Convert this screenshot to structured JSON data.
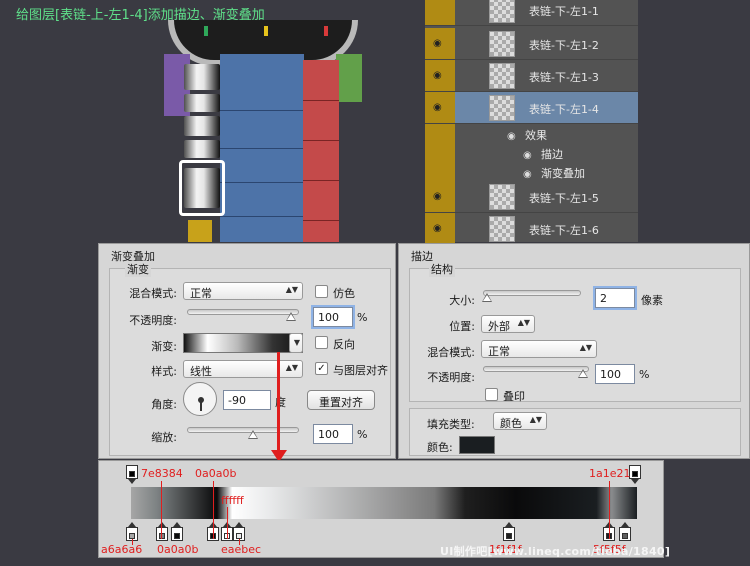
{
  "title": "给图层[表链-上-左1-4]添加描边、渐变叠加",
  "layers": {
    "items": [
      {
        "name": "表链-下-左1-1"
      },
      {
        "name": "表链-下-左1-2"
      },
      {
        "name": "表链-下-左1-3"
      },
      {
        "name": "表链-下-左1-4",
        "selected": true
      },
      {
        "name": "表链-下-左1-5"
      },
      {
        "name": "表链-下-左1-6"
      }
    ],
    "effects_label": "效果",
    "effect_items": [
      "描边",
      "渐变叠加"
    ]
  },
  "gradient_overlay": {
    "title": "渐变叠加",
    "group_label": "渐变",
    "blend_mode_label": "混合模式:",
    "blend_mode_value": "正常",
    "dither_label": "仿色",
    "opacity_label": "不透明度:",
    "opacity_value": "100",
    "opacity_unit": "%",
    "gradient_label": "渐变:",
    "reverse_label": "反向",
    "style_label": "样式:",
    "style_value": "线性",
    "align_label": "与图层对齐",
    "angle_label": "角度:",
    "angle_value": "-90",
    "angle_unit": "度",
    "reset_button": "重置对齐",
    "scale_label": "缩放:",
    "scale_value": "100",
    "scale_unit": "%"
  },
  "stroke": {
    "title": "描边",
    "group_label": "结构",
    "size_label": "大小:",
    "size_value": "2",
    "size_unit": "像素",
    "position_label": "位置:",
    "position_value": "外部",
    "blend_mode_label": "混合模式:",
    "blend_mode_value": "正常",
    "opacity_label": "不透明度:",
    "opacity_value": "100",
    "opacity_unit": "%",
    "overprint_label": "叠印",
    "fill_type_label": "填充类型:",
    "fill_type_value": "颜色",
    "color_label": "颜色:",
    "color_value": "#1a1e21"
  },
  "gradient_editor": {
    "labels": {
      "c1": "7e8384",
      "c2": "0a0a0b",
      "c3": "ffffff",
      "c4": "1a1e21",
      "b1": "a6a6a6",
      "b2": "0a0a0b",
      "b3": "eaebec",
      "b4": "1f1f1f",
      "b5": "5f5f5f"
    }
  },
  "watermark": "UI制作吧[www.lineq.com/tieba/1840]",
  "colors": {
    "accent_green": "#5fe08a",
    "annotation_red": "#e01e1e",
    "layer_selected": "#6b87a8"
  }
}
